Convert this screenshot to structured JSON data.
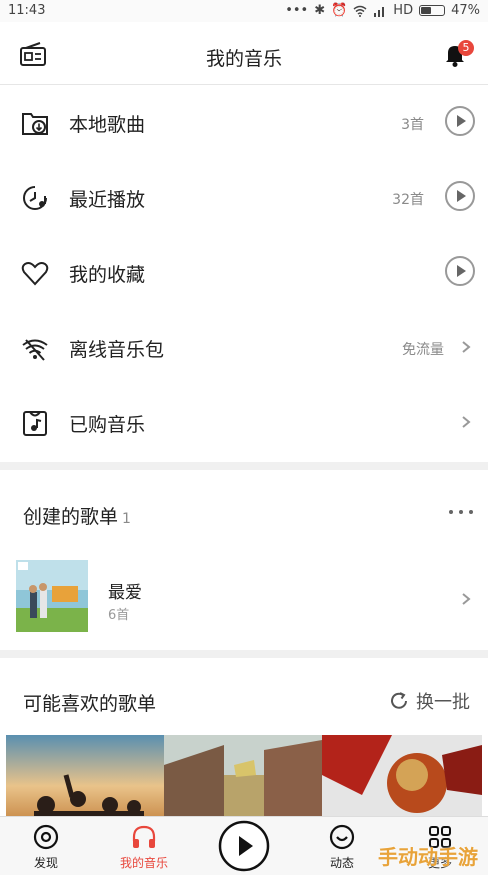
{
  "status_bar": {
    "time": "11:43",
    "network": "HD",
    "battery": "47%",
    "battery_level": 0.47
  },
  "header": {
    "title": "我的音乐",
    "left_icon": "radio-icon",
    "right_icon": "bell-icon",
    "notification_count": "5"
  },
  "menu": [
    {
      "label": "本地歌曲",
      "meta": "3首",
      "icon": "local-music-folder-icon",
      "action": "play-icon"
    },
    {
      "label": "最近播放",
      "meta": "32首",
      "icon": "recent-clock-icon",
      "action": "play-icon"
    },
    {
      "label": "我的收藏",
      "meta": "",
      "icon": "heart-icon",
      "action": "play-icon"
    },
    {
      "label": "离线音乐包",
      "meta": "免流量",
      "icon": "offline-wifi-icon",
      "action": "chevron-right-icon"
    },
    {
      "label": "已购音乐",
      "meta": "",
      "icon": "purchased-music-icon",
      "action": "chevron-right-icon"
    }
  ],
  "created_playlists": {
    "title": "创建的歌单",
    "count": "1",
    "more_icon": "more-dots-icon",
    "items": [
      {
        "name": "最爱",
        "count": "6首"
      }
    ]
  },
  "recommended": {
    "title": "可能喜欢的歌单",
    "refresh_label": "换一批",
    "refresh_icon": "refresh-icon"
  },
  "tabs": [
    {
      "label": "发现",
      "icon": "discover-icon",
      "active": false
    },
    {
      "label": "我的音乐",
      "icon": "headphones-icon",
      "active": true
    },
    {
      "label": "",
      "icon": "play-circle-icon",
      "active": false
    },
    {
      "label": "动态",
      "icon": "feed-icon",
      "active": false
    },
    {
      "label": "更多",
      "icon": "apps-grid-icon",
      "active": false
    }
  ],
  "watermark": "手动动手游",
  "colors": {
    "accent": "#e8473c",
    "text": "#222222",
    "muted": "#8a8a8a",
    "separator": "#f0f0f0"
  }
}
